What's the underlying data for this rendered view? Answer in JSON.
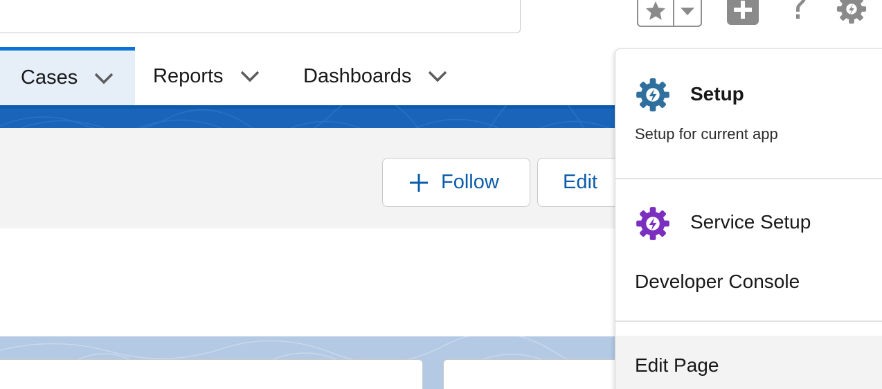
{
  "nav": {
    "tabs": [
      {
        "label": "Cases",
        "active": true
      },
      {
        "label": "Reports",
        "active": false
      },
      {
        "label": "Dashboards",
        "active": false
      }
    ]
  },
  "record_header": {
    "follow_label": "Follow",
    "edit_label": "Edit"
  },
  "setup_menu": {
    "setup_title": "Setup",
    "setup_description": "Setup for current app",
    "service_setup_label": "Service Setup",
    "developer_console_label": "Developer Console",
    "edit_page_label": "Edit Page"
  },
  "colors": {
    "accent": "#0b73d5",
    "band": "#1a65ba",
    "setup_gear": "#2e6f9e",
    "service_gear": "#7b2fbf",
    "link_text": "#0b5cab"
  },
  "icons": [
    "star-icon",
    "chevron-down-icon",
    "plus-icon",
    "help-icon",
    "gear-icon",
    "setup-gear-icon",
    "service-setup-gear-icon"
  ]
}
